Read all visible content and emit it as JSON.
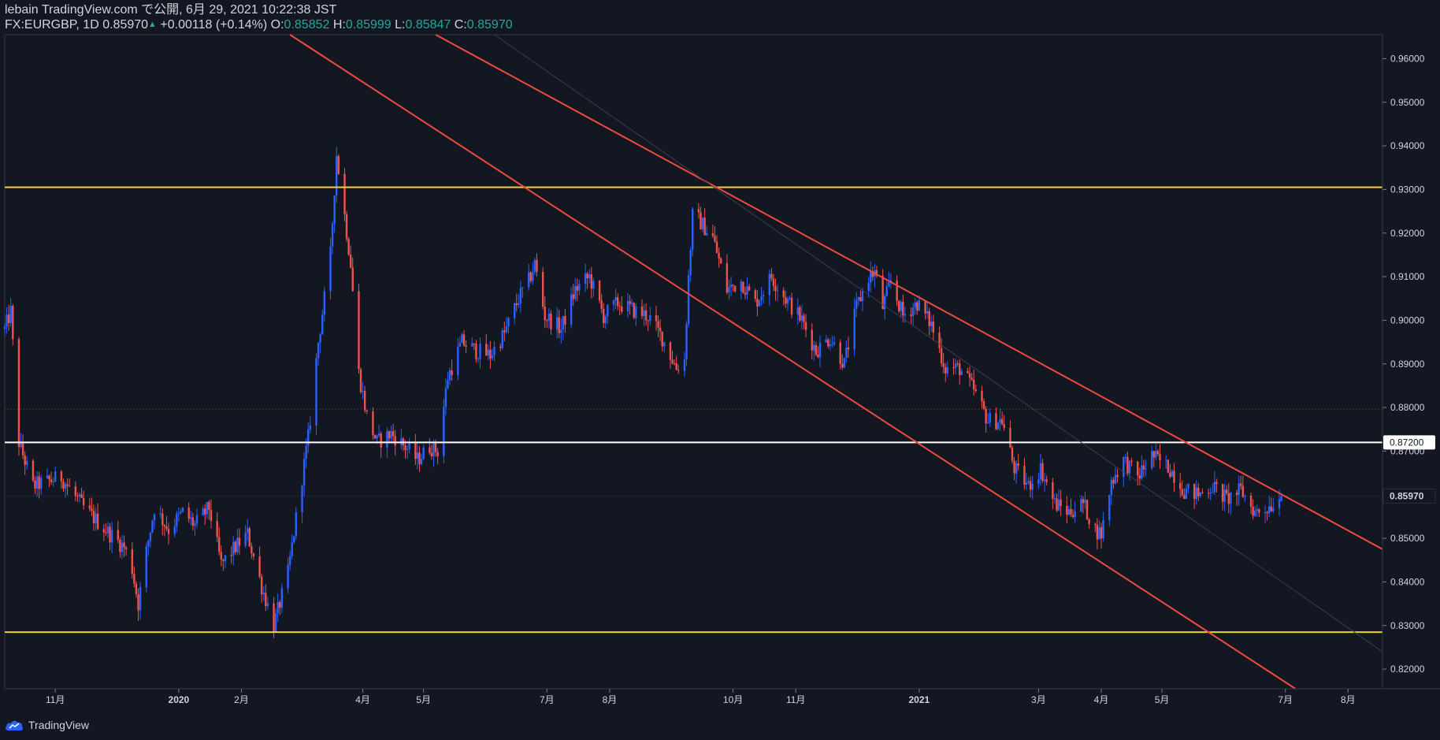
{
  "header": {
    "publish_line": "lebain TradingView.com で公開, 6月 29, 2021 10:22:38 JST",
    "symbol": "FX:EURGBP, 1D",
    "last": "0.85970",
    "change": "+0.00118 (+0.14%)",
    "o_label": "O:",
    "o_value": "0.85852",
    "h_label": "H:",
    "h_value": "0.85999",
    "l_label": "L:",
    "l_value": "0.85847",
    "c_label": "C:",
    "c_value": "0.85970"
  },
  "footer": {
    "brand": "TradingView"
  },
  "colors": {
    "background": "#131722",
    "up": "#2962ff",
    "down": "#ef5350",
    "support_resistance": "#f0d034",
    "level": "#ffffff",
    "channel": "#f04a3e",
    "axis_text": "#d1d4dc",
    "grid": "#1e222d"
  },
  "chart_data": {
    "type": "candlestick",
    "title": "",
    "ylim": [
      0.8155,
      0.9655
    ],
    "y_ticks": [
      "0.96000",
      "0.95000",
      "0.94000",
      "0.93000",
      "0.92000",
      "0.91000",
      "0.90000",
      "0.89000",
      "0.88000",
      "0.87000",
      "0.86000",
      "0.85000",
      "0.84000",
      "0.83000",
      "0.82000"
    ],
    "x_ticks": [
      {
        "label": "11月",
        "date": "2019-11-01"
      },
      {
        "label": "2020",
        "date": "2020-01-01"
      },
      {
        "label": "2月",
        "date": "2020-02-01"
      },
      {
        "label": "4月",
        "date": "2020-04-01"
      },
      {
        "label": "5月",
        "date": "2020-05-01"
      },
      {
        "label": "7月",
        "date": "2020-07-01"
      },
      {
        "label": "8月",
        "date": "2020-08-01"
      },
      {
        "label": "10月",
        "date": "2020-10-01"
      },
      {
        "label": "11月",
        "date": "2020-11-01"
      },
      {
        "label": "2021",
        "date": "2021-01-01"
      },
      {
        "label": "3月",
        "date": "2021-03-01"
      },
      {
        "label": "4月",
        "date": "2021-04-01"
      },
      {
        "label": "5月",
        "date": "2021-05-01"
      },
      {
        "label": "7月",
        "date": "2021-07-01"
      },
      {
        "label": "8月",
        "date": "2021-08-01"
      }
    ],
    "x_range": [
      "2019-10-07",
      "2021-08-18"
    ],
    "price_path": [
      [
        "2019-10-07",
        0.898
      ],
      [
        "2019-10-10",
        0.902
      ],
      [
        "2019-10-14",
        0.872
      ],
      [
        "2019-10-21",
        0.862
      ],
      [
        "2019-11-04",
        0.864
      ],
      [
        "2019-11-15",
        0.857
      ],
      [
        "2019-11-28",
        0.851
      ],
      [
        "2019-12-05",
        0.848
      ],
      [
        "2019-12-09",
        0.843
      ],
      [
        "2019-12-12",
        0.835
      ],
      [
        "2019-12-16",
        0.847
      ],
      [
        "2019-12-20",
        0.857
      ],
      [
        "2019-12-27",
        0.852
      ],
      [
        "2020-01-03",
        0.856
      ],
      [
        "2020-01-09",
        0.853
      ],
      [
        "2020-01-16",
        0.857
      ],
      [
        "2020-01-22",
        0.844
      ],
      [
        "2020-01-29",
        0.848
      ],
      [
        "2020-02-04",
        0.851
      ],
      [
        "2020-02-11",
        0.839
      ],
      [
        "2020-02-17",
        0.83
      ],
      [
        "2020-02-24",
        0.842
      ],
      [
        "2020-03-02",
        0.864
      ],
      [
        "2020-03-05",
        0.873
      ],
      [
        "2020-03-10",
        0.895
      ],
      [
        "2020-03-16",
        0.915
      ],
      [
        "2020-03-19",
        0.938
      ],
      [
        "2020-03-23",
        0.924
      ],
      [
        "2020-03-26",
        0.913
      ],
      [
        "2020-03-30",
        0.888
      ],
      [
        "2020-04-03",
        0.878
      ],
      [
        "2020-04-08",
        0.872
      ],
      [
        "2020-04-15",
        0.874
      ],
      [
        "2020-04-22",
        0.871
      ],
      [
        "2020-04-28",
        0.868
      ],
      [
        "2020-05-04",
        0.871
      ],
      [
        "2020-05-08",
        0.87
      ],
      [
        "2020-05-13",
        0.887
      ],
      [
        "2020-05-20",
        0.895
      ],
      [
        "2020-05-27",
        0.893
      ],
      [
        "2020-06-03",
        0.892
      ],
      [
        "2020-06-10",
        0.897
      ],
      [
        "2020-06-17",
        0.905
      ],
      [
        "2020-06-22",
        0.909
      ],
      [
        "2020-06-25",
        0.913
      ],
      [
        "2020-06-30",
        0.901
      ],
      [
        "2020-07-08",
        0.898
      ],
      [
        "2020-07-15",
        0.907
      ],
      [
        "2020-07-22",
        0.91
      ],
      [
        "2020-07-29",
        0.901
      ],
      [
        "2020-08-05",
        0.904
      ],
      [
        "2020-08-14",
        0.902
      ],
      [
        "2020-08-20",
        0.901
      ],
      [
        "2020-08-27",
        0.896
      ],
      [
        "2020-09-03",
        0.889
      ],
      [
        "2020-09-07",
        0.891
      ],
      [
        "2020-09-09",
        0.91
      ],
      [
        "2020-09-11",
        0.924
      ],
      [
        "2020-09-14",
        0.923
      ],
      [
        "2020-09-21",
        0.919
      ],
      [
        "2020-09-28",
        0.907
      ],
      [
        "2020-10-05",
        0.909
      ],
      [
        "2020-10-12",
        0.904
      ],
      [
        "2020-10-20",
        0.91
      ],
      [
        "2020-10-27",
        0.905
      ],
      [
        "2020-11-04",
        0.9
      ],
      [
        "2020-11-11",
        0.893
      ],
      [
        "2020-11-18",
        0.896
      ],
      [
        "2020-11-25",
        0.89
      ],
      [
        "2020-12-01",
        0.903
      ],
      [
        "2020-12-07",
        0.91
      ],
      [
        "2020-12-10",
        0.911
      ],
      [
        "2020-12-14",
        0.903
      ],
      [
        "2020-12-18",
        0.909
      ],
      [
        "2020-12-24",
        0.901
      ],
      [
        "2020-12-31",
        0.904
      ],
      [
        "2021-01-07",
        0.899
      ],
      [
        "2021-01-14",
        0.889
      ],
      [
        "2021-01-21",
        0.889
      ],
      [
        "2021-01-28",
        0.884
      ],
      [
        "2021-02-04",
        0.877
      ],
      [
        "2021-02-11",
        0.877
      ],
      [
        "2021-02-17",
        0.866
      ],
      [
        "2021-02-24",
        0.862
      ],
      [
        "2021-03-02",
        0.866
      ],
      [
        "2021-03-09",
        0.858
      ],
      [
        "2021-03-16",
        0.856
      ],
      [
        "2021-03-23",
        0.858
      ],
      [
        "2021-03-29",
        0.852
      ],
      [
        "2021-04-01",
        0.851
      ],
      [
        "2021-04-06",
        0.863
      ],
      [
        "2021-04-12",
        0.868
      ],
      [
        "2021-04-19",
        0.864
      ],
      [
        "2021-04-26",
        0.869
      ],
      [
        "2021-05-05",
        0.866
      ],
      [
        "2021-05-12",
        0.861
      ],
      [
        "2021-05-19",
        0.86
      ],
      [
        "2021-05-26",
        0.862
      ],
      [
        "2021-06-02",
        0.859
      ],
      [
        "2021-06-09",
        0.861
      ],
      [
        "2021-06-16",
        0.856
      ],
      [
        "2021-06-22",
        0.857
      ],
      [
        "2021-06-29",
        0.8597
      ]
    ],
    "horizontal_levels": [
      {
        "price": 0.9305,
        "kind": "resistance"
      },
      {
        "price": 0.8285,
        "kind": "support"
      },
      {
        "price": 0.872,
        "kind": "level",
        "label": "0.87200"
      }
    ],
    "channel_lines": [
      {
        "kind": "upper",
        "from": [
          "2020-05-07",
          0.9655
        ],
        "to": [
          "2021-08-18",
          0.8475
        ]
      },
      {
        "kind": "lower",
        "from": [
          "2020-02-25",
          0.9655
        ],
        "to": [
          "2021-07-06",
          0.8155
        ]
      }
    ],
    "midline": {
      "from": [
        "2020-06-05",
        0.9655
      ],
      "to": [
        "2021-08-18",
        0.824
      ]
    },
    "current_price": {
      "price": 0.8597,
      "label": "0.85970"
    },
    "dotted_level": 0.8796
  }
}
